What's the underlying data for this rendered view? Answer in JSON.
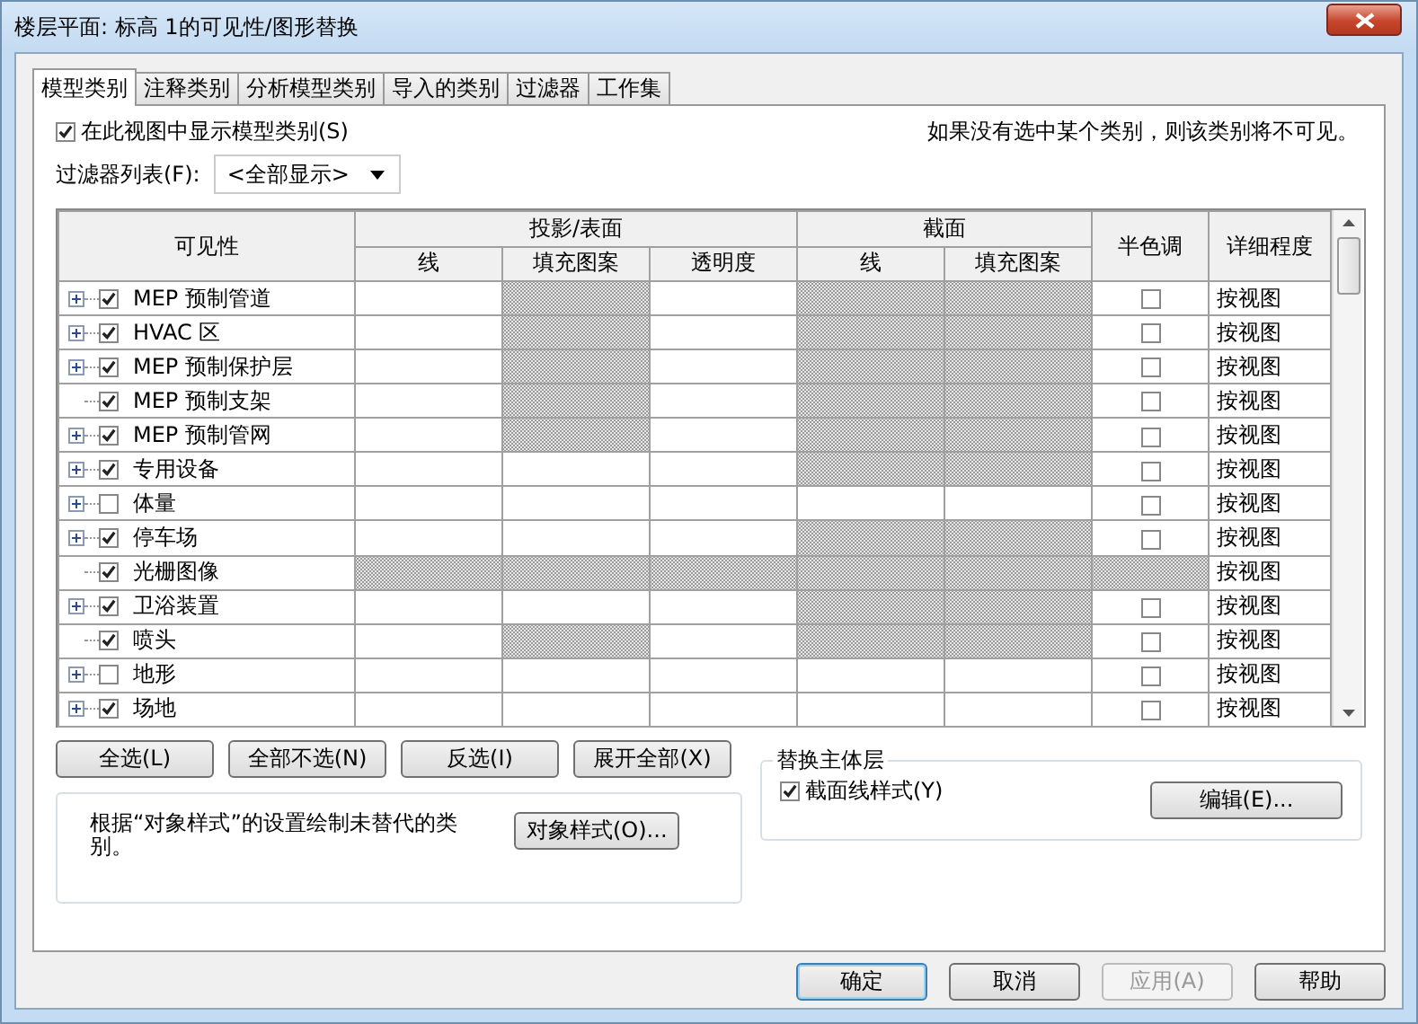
{
  "window": {
    "title": "楼层平面: 标高 1的可见性/图形替换"
  },
  "tabs": [
    {
      "label": "模型类别",
      "selected": true
    },
    {
      "label": "注释类别",
      "selected": false
    },
    {
      "label": "分析模型类别",
      "selected": false
    },
    {
      "label": "导入的类别",
      "selected": false
    },
    {
      "label": "过滤器",
      "selected": false
    },
    {
      "label": "工作集",
      "selected": false
    }
  ],
  "show_categories": {
    "label": "在此视图中显示模型类别(S)",
    "checked": true
  },
  "hint": "如果没有选中某个类别，则该类别将不可见。",
  "filter_list": {
    "label": "过滤器列表(F):",
    "value": "<全部显示>"
  },
  "table": {
    "visibility": "可见性",
    "projection_surface": "投影/表面",
    "projection_columns": [
      "线",
      "填充图案",
      "透明度"
    ],
    "cut": "截面",
    "cut_columns": [
      "线",
      "填充图案"
    ],
    "halftone": "半色调",
    "detail_level": "详细程度",
    "rows": [
      {
        "name": "MEP 预制管道",
        "expandable": true,
        "checked": true,
        "hatched": [
          false,
          true,
          false,
          true,
          true,
          false
        ],
        "halftone_checked": false,
        "detail": "按视图"
      },
      {
        "name": "HVAC 区",
        "expandable": true,
        "checked": true,
        "hatched": [
          false,
          true,
          false,
          true,
          true,
          false
        ],
        "halftone_checked": false,
        "detail": "按视图"
      },
      {
        "name": "MEP 预制保护层",
        "expandable": true,
        "checked": true,
        "hatched": [
          false,
          true,
          false,
          true,
          true,
          false
        ],
        "halftone_checked": false,
        "detail": "按视图"
      },
      {
        "name": "MEP 预制支架",
        "expandable": false,
        "checked": true,
        "hatched": [
          false,
          true,
          false,
          true,
          true,
          false
        ],
        "halftone_checked": false,
        "detail": "按视图"
      },
      {
        "name": "MEP 预制管网",
        "expandable": true,
        "checked": true,
        "hatched": [
          false,
          true,
          false,
          true,
          true,
          false
        ],
        "halftone_checked": false,
        "detail": "按视图"
      },
      {
        "name": "专用设备",
        "expandable": true,
        "checked": true,
        "hatched": [
          false,
          false,
          false,
          true,
          true,
          false
        ],
        "halftone_checked": false,
        "detail": "按视图"
      },
      {
        "name": "体量",
        "expandable": true,
        "checked": false,
        "hatched": [
          false,
          false,
          false,
          false,
          false,
          false
        ],
        "halftone_checked": false,
        "detail": "按视图"
      },
      {
        "name": "停车场",
        "expandable": true,
        "checked": true,
        "hatched": [
          false,
          false,
          false,
          true,
          true,
          false
        ],
        "halftone_checked": false,
        "detail": "按视图"
      },
      {
        "name": "光栅图像",
        "expandable": false,
        "checked": true,
        "hatched": [
          true,
          true,
          true,
          true,
          true,
          true
        ],
        "detail": "按视图"
      },
      {
        "name": "卫浴装置",
        "expandable": true,
        "checked": true,
        "hatched": [
          false,
          false,
          false,
          true,
          true,
          false
        ],
        "halftone_checked": false,
        "detail": "按视图"
      },
      {
        "name": "喷头",
        "expandable": false,
        "checked": true,
        "hatched": [
          false,
          true,
          false,
          true,
          true,
          false
        ],
        "halftone_checked": false,
        "detail": "按视图"
      },
      {
        "name": "地形",
        "expandable": true,
        "checked": false,
        "hatched": [
          false,
          false,
          false,
          false,
          false,
          false
        ],
        "halftone_checked": false,
        "detail": "按视图"
      },
      {
        "name": "场地",
        "expandable": true,
        "checked": true,
        "hatched": [
          false,
          false,
          false,
          false,
          false,
          false
        ],
        "halftone_checked": false,
        "detail": "按视图"
      }
    ]
  },
  "list_buttons": [
    "全选(L)",
    "全部不选(N)",
    "反选(I)",
    "展开全部(X)"
  ],
  "object_styles": {
    "text": "根据“对象样式”的设置绘制未替代的类别。",
    "button": "对象样式(O)..."
  },
  "host_layers": {
    "title": "替换主体层",
    "checkbox": {
      "label": "截面线样式(Y)",
      "checked": true
    },
    "button": "编辑(E)..."
  },
  "dialog_buttons": [
    {
      "label": "确定",
      "default": true,
      "disabled": false
    },
    {
      "label": "取消",
      "default": false,
      "disabled": false
    },
    {
      "label": "应用(A)",
      "default": false,
      "disabled": true
    },
    {
      "label": "帮助",
      "default": false,
      "disabled": false
    }
  ]
}
